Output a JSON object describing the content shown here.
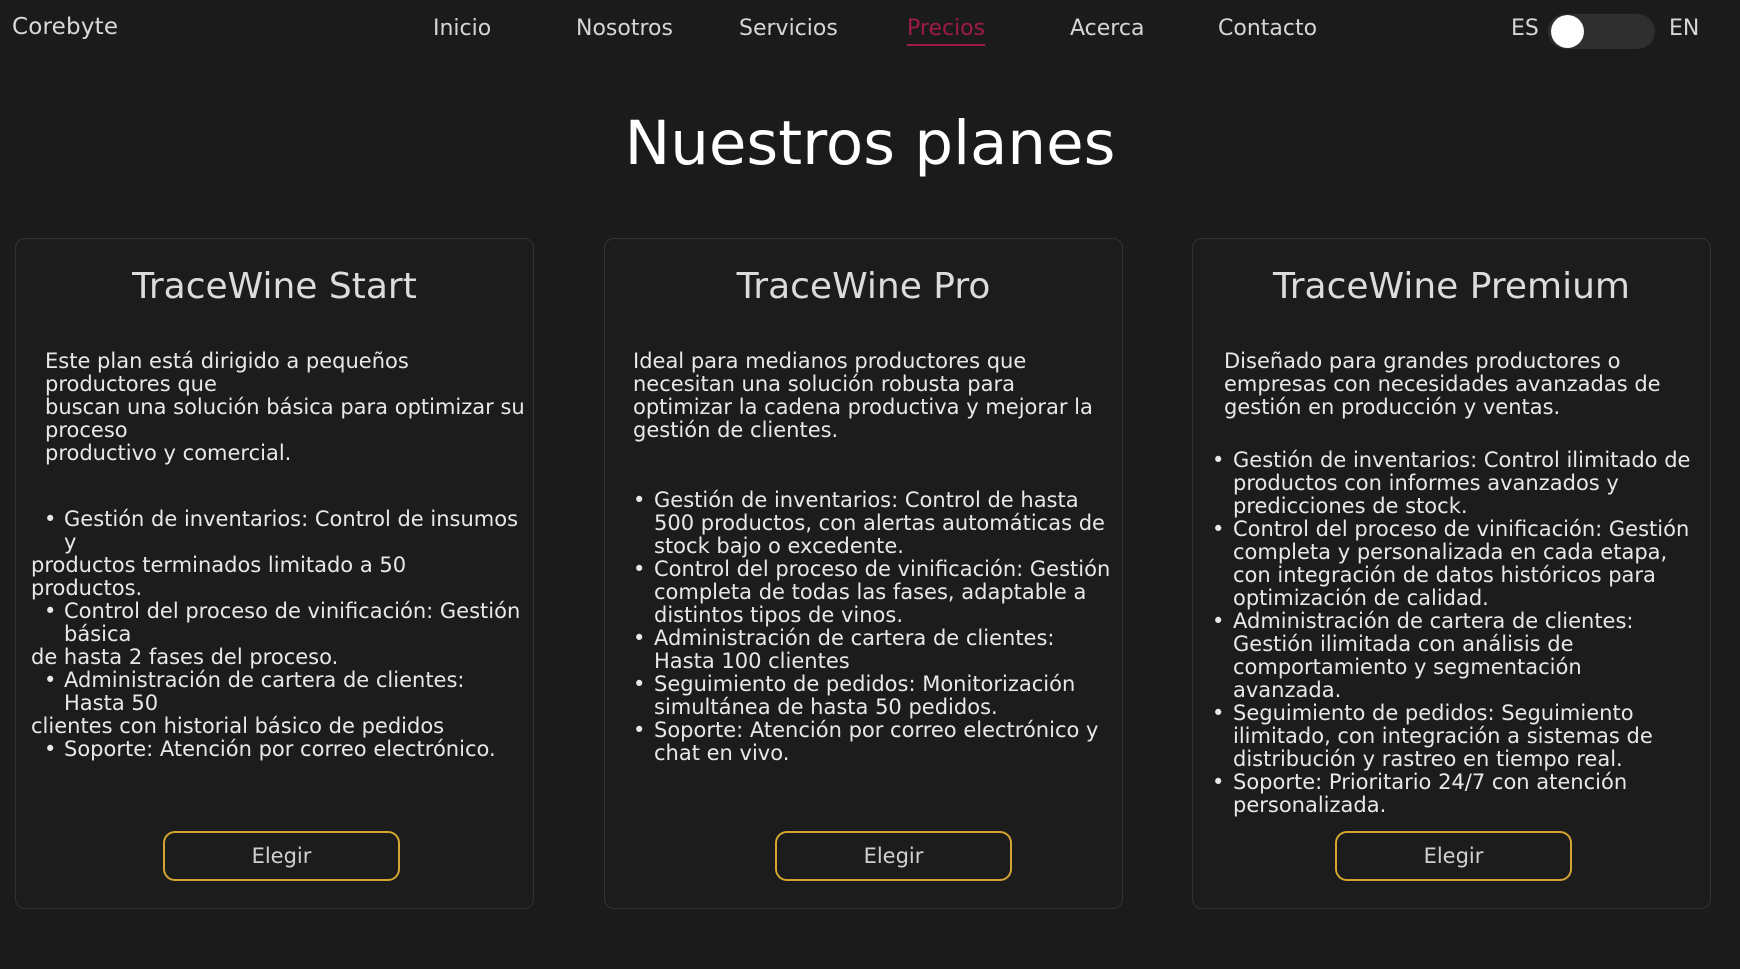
{
  "nav": {
    "brand": "Corebyte",
    "links": [
      "Inicio",
      "Nosotros",
      "Servicios",
      "Precios",
      "Acerca",
      "Contacto"
    ],
    "active_link": "Precios",
    "lang_left": "ES",
    "lang_right": "EN",
    "lang_selected": "ES"
  },
  "page": {
    "title": "Nuestros planes"
  },
  "plans": [
    {
      "name": "TraceWine Start",
      "description_lines": [
        "Este plan está dirigido a pequeños",
        "productores que",
        "buscan una solución básica para optimizar su",
        "proceso",
        "productivo y comercial."
      ],
      "features": [
        {
          "lines": [
            "Gestión de inventarios: Control de insumos",
            "y"
          ],
          "continuation": [
            "productos terminados limitado a 50",
            "productos."
          ]
        },
        {
          "lines": [
            "Control del proceso de vinificación: Gestión",
            "básica"
          ],
          "continuation": [
            "de hasta 2 fases del proceso."
          ]
        },
        {
          "lines": [
            "Administración de cartera de clientes:",
            "Hasta 50"
          ],
          "continuation": [
            "clientes con historial básico de pedidos"
          ]
        },
        {
          "lines": [
            "Soporte: Atención por correo electrónico."
          ],
          "continuation": []
        }
      ],
      "button": "Elegir"
    },
    {
      "name": "TraceWine Pro",
      "description_lines": [
        "Ideal para medianos productores que",
        "necesitan una solución robusta para",
        "optimizar la cadena productiva y mejorar la",
        "gestión de clientes."
      ],
      "features": [
        {
          "lines": [
            "Gestión de inventarios: Control de hasta",
            "500 productos, con alertas automáticas de",
            "stock bajo o excedente."
          ]
        },
        {
          "lines": [
            "Control del proceso de vinificación: Gestión",
            "completa de todas las fases, adaptable a",
            "distintos tipos de vinos."
          ]
        },
        {
          "lines": [
            "Administración de cartera de clientes:",
            "Hasta 100 clientes"
          ]
        },
        {
          "lines": [
            "Seguimiento de pedidos: Monitorización",
            "simultánea de hasta 50 pedidos."
          ]
        },
        {
          "lines": [
            "Soporte: Atención por correo electrónico y",
            "chat en vivo."
          ]
        }
      ],
      "button": "Elegir"
    },
    {
      "name": "TraceWine Premium",
      "description_lines": [
        "Diseñado para grandes productores o",
        "empresas con necesidades avanzadas de",
        "gestión en producción y ventas."
      ],
      "features": [
        {
          "lines": [
            "Gestión de inventarios: Control ilimitado de",
            "productos con informes avanzados y",
            "predicciones de stock."
          ]
        },
        {
          "lines": [
            "Control del proceso de vinificación: Gestión",
            "completa y personalizada en cada etapa,",
            "con integración de datos históricos para",
            "optimización de calidad."
          ]
        },
        {
          "lines": [
            "Administración de cartera de clientes:",
            "Gestión ilimitada con análisis de",
            "comportamiento y segmentación",
            "avanzada."
          ]
        },
        {
          "lines": [
            "Seguimiento de pedidos: Seguimiento",
            "ilimitado, con integración a sistemas de",
            "distribución y rastreo en tiempo real."
          ]
        },
        {
          "lines": [
            "Soporte: Prioritario 24/7 con atención",
            "personalizada."
          ]
        }
      ],
      "button": "Elegir"
    }
  ]
}
